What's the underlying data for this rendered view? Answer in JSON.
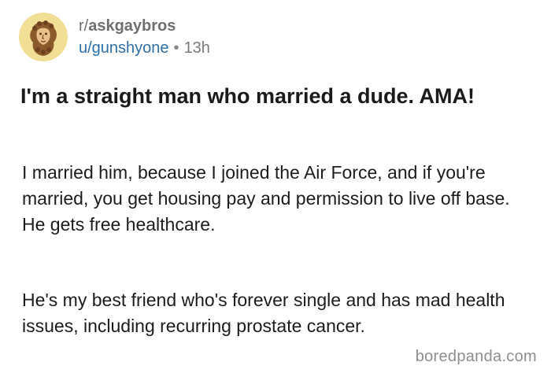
{
  "post": {
    "subreddit_prefix": "r/",
    "subreddit_name": "askgaybros",
    "username": "u/gunshyone",
    "separator": "•",
    "age": "13h",
    "title": "I'm a straight man who married a dude. AMA!",
    "paragraphs": [
      "I married him, because I joined the Air Force, and if you're married, you get housing pay and permission to live off base. He gets free healthcare.",
      "He's my best friend who's forever single and has mad health issues, including recurring prostate cancer."
    ]
  },
  "avatar": {
    "icon": "statue-head-icon",
    "background_color": "#f1df95"
  },
  "watermark": "boredpanda.com",
  "colors": {
    "username": "#2f6fa8",
    "meta_text": "#6f6f6f",
    "title_text": "#1a1a1b"
  }
}
